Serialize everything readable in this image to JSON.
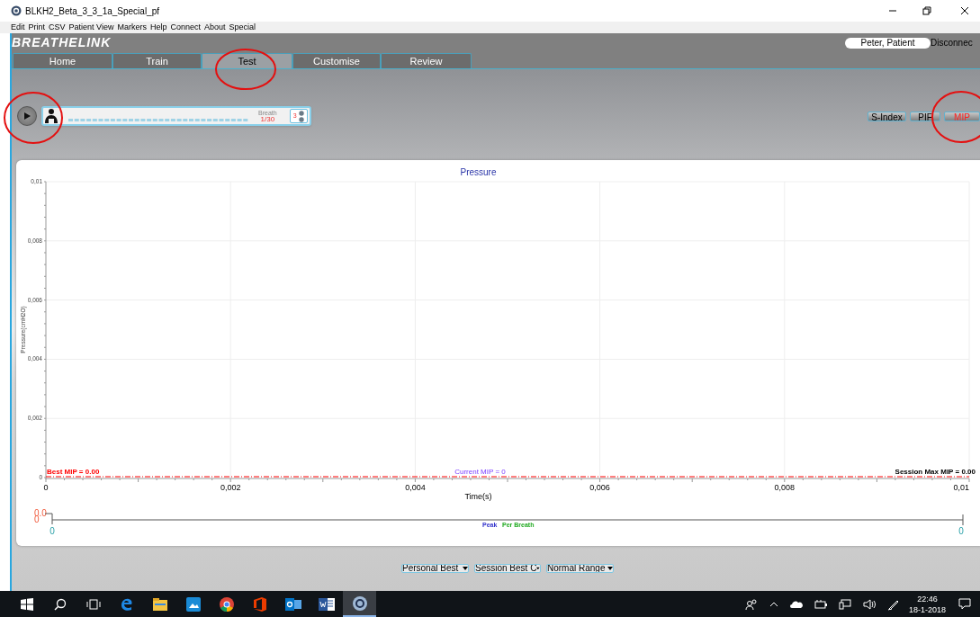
{
  "window": {
    "title": "BLKH2_Beta_3_3_1a_Special_pf"
  },
  "menu": [
    "Edit",
    "Print",
    "CSV",
    "Patient View",
    "Markers",
    "Help",
    "Connect",
    "About",
    "Special"
  ],
  "logo": "BREATHELINK",
  "patient": "Peter, Patient",
  "connection": "Disconnec",
  "tabs": [
    {
      "label": "Home",
      "selected": false
    },
    {
      "label": "Train",
      "selected": false
    },
    {
      "label": "Test",
      "selected": true
    },
    {
      "label": "Customise",
      "selected": false
    },
    {
      "label": "Review",
      "selected": false
    }
  ],
  "toolbar": {
    "breath_label": "Breath",
    "breath_count": "1/30",
    "level_value": "3"
  },
  "modes": [
    {
      "label": "S-Index",
      "selected": false
    },
    {
      "label": "PIF",
      "selected": false
    },
    {
      "label": "MIP",
      "selected": true
    }
  ],
  "chart": {
    "chart_data": {
      "type": "line",
      "title": "Pressure",
      "xlabel": "Time(s)",
      "ylabel": "Pressure(cmH2O)",
      "grid": true,
      "xlim": [
        0,
        0.01
      ],
      "ylim": [
        0,
        0.01
      ],
      "xticks": [
        {
          "value": 0,
          "label": "0"
        },
        {
          "value": 0.002,
          "label": "0,002"
        },
        {
          "value": 0.004,
          "label": "0,004"
        },
        {
          "value": 0.006,
          "label": "0,006"
        },
        {
          "value": 0.008,
          "label": "0,008"
        },
        {
          "value": 0.01,
          "label": "0,01"
        }
      ],
      "yticks": [
        {
          "value": 0,
          "label": "0"
        },
        {
          "value": 0.002,
          "label": "0,002"
        },
        {
          "value": 0.004,
          "label": "0,004"
        },
        {
          "value": 0.006,
          "label": "0,006"
        },
        {
          "value": 0.008,
          "label": "0,008"
        },
        {
          "value": 0.01,
          "label": "0,01"
        }
      ],
      "annotations": [
        "Best MIP = 0.00",
        "Current MIP = 0",
        "Session Max MIP = 0.00"
      ]
    }
  },
  "strip": {
    "top_value": "0.0",
    "bottom_value": "0",
    "left_value": "0",
    "right_value": "0",
    "legend": [
      {
        "label": "Peak",
        "color": "#3333cc"
      },
      {
        "label": "Per Breath",
        "color": "#22aa22"
      }
    ]
  },
  "dropdowns": [
    "Personal Best",
    "Session Best C",
    "Normal Range"
  ],
  "taskbar": {
    "apps": [
      {
        "kind": "start",
        "active": false
      },
      {
        "kind": "search",
        "active": false
      },
      {
        "kind": "taskview",
        "active": false
      },
      {
        "kind": "edge",
        "active": false
      },
      {
        "kind": "explorer",
        "active": false
      },
      {
        "kind": "photos",
        "active": false
      },
      {
        "kind": "chrome",
        "active": false
      },
      {
        "kind": "office",
        "active": false
      },
      {
        "kind": "outlook",
        "active": false
      },
      {
        "kind": "word",
        "active": false
      },
      {
        "kind": "app",
        "active": true
      }
    ],
    "time": "22:46",
    "date": "18-1-2018"
  }
}
